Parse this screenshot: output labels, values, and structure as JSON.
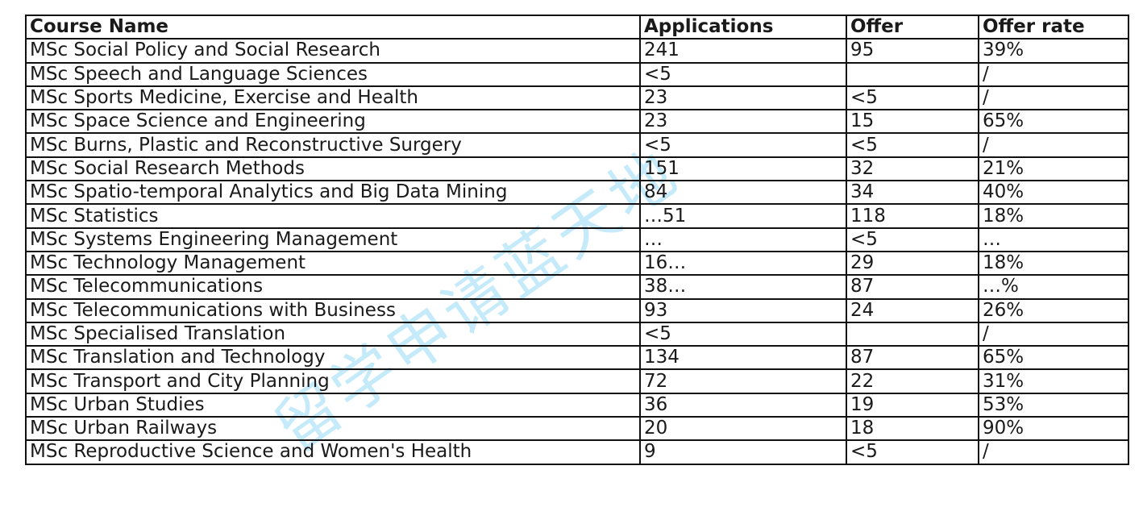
{
  "watermark": "留学申请蓝天地",
  "table": {
    "headers": [
      "Course Name",
      "Applications",
      "Offer",
      "Offer rate"
    ],
    "rows": [
      [
        "MSc Social Policy and Social Research",
        "241",
        "95",
        "39%"
      ],
      [
        "MSc Speech and Language Sciences",
        "<5",
        "",
        "/"
      ],
      [
        "MSc Sports Medicine, Exercise and Health",
        "23",
        "<5",
        "/"
      ],
      [
        "MSc Space Science and Engineering",
        "23",
        "15",
        "65%"
      ],
      [
        "MSc Burns, Plastic and Reconstructive Surgery",
        "<5",
        "<5",
        "/"
      ],
      [
        "MSc Social Research Methods",
        "151",
        "32",
        "21%"
      ],
      [
        "MSc Spatio-temporal Analytics and Big Data Mining",
        "84",
        "34",
        "40%"
      ],
      [
        "MSc Statistics",
        "…51",
        "118",
        "18%"
      ],
      [
        "MSc Systems Engineering Management",
        "…",
        "<5",
        "…"
      ],
      [
        "MSc Technology Management",
        "16…",
        "29",
        "18%"
      ],
      [
        "MSc Telecommunications",
        "38…",
        "87",
        "…%"
      ],
      [
        "MSc Telecommunications with Business",
        "93",
        "24",
        "26%"
      ],
      [
        "MSc Specialised Translation",
        "<5",
        "",
        "/"
      ],
      [
        "MSc Translation and Technology",
        "134",
        "87",
        "65%"
      ],
      [
        "MSc Transport and City Planning",
        "72",
        "22",
        "31%"
      ],
      [
        "MSc Urban Studies",
        "36",
        "19",
        "53%"
      ],
      [
        "MSc Urban Railways",
        "20",
        "18",
        "90%"
      ],
      [
        "MSc Reproductive Science and Women's Health",
        "9",
        "<5",
        "/"
      ]
    ]
  }
}
